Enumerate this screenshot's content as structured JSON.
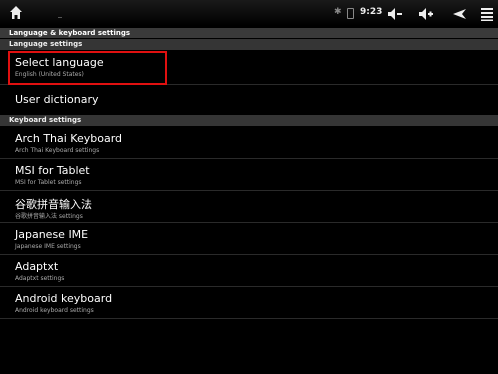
{
  "status": {
    "time": "9:23"
  },
  "title": "Language & keyboard settings",
  "sections": {
    "language": "Language settings",
    "keyboard": "Keyboard settings"
  },
  "items": [
    {
      "title": "Select language",
      "summary": "English (United States)"
    },
    {
      "title": "User dictionary",
      "summary": ""
    },
    {
      "title": "Arch Thai Keyboard",
      "summary": "Arch Thai Keyboard settings"
    },
    {
      "title": "MSI for Tablet",
      "summary": "MSI for Tablet settings"
    },
    {
      "title": "谷歌拼音输入法",
      "summary": "谷歌拼音输入法 settings"
    },
    {
      "title": "Japanese IME",
      "summary": "Japanese IME settings"
    },
    {
      "title": "Adaptxt",
      "summary": "Adaptxt settings"
    },
    {
      "title": "Android keyboard",
      "summary": "Android keyboard settings"
    }
  ],
  "highlight_color": "#e01010",
  "icons": [
    "home-icon",
    "bluetooth-icon",
    "battery-icon",
    "volume-down-icon",
    "volume-up-icon",
    "back-icon",
    "menu-icon"
  ]
}
